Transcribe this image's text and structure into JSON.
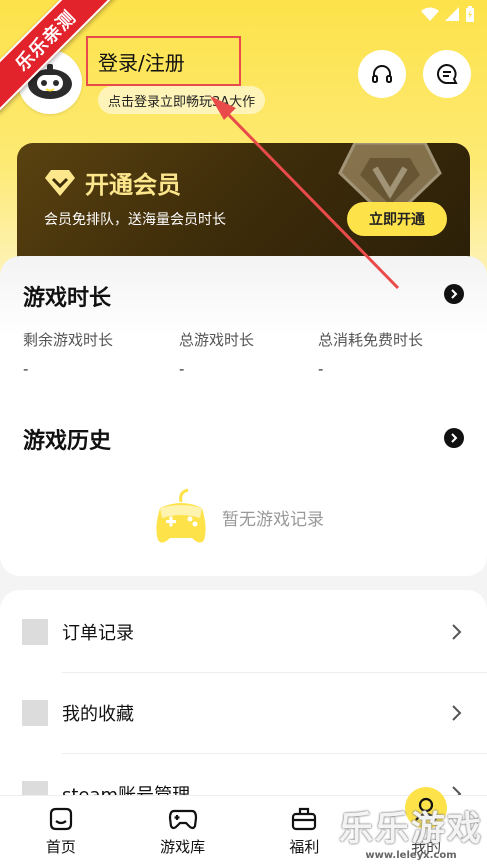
{
  "ribbon": "乐乐亲测",
  "header": {
    "login_label": "登录/注册",
    "login_hint": "点击登录立即畅玩3A大作"
  },
  "vip": {
    "title": "开通会员",
    "subtitle": "会员免排队，送海量会员时长",
    "button": "立即开通"
  },
  "game_time": {
    "title": "游戏时长",
    "stats": [
      {
        "label": "剩余游戏时长",
        "value": "-"
      },
      {
        "label": "总游戏时长",
        "value": "-"
      },
      {
        "label": "总消耗免费时长",
        "value": "-"
      }
    ]
  },
  "history": {
    "title": "游戏历史",
    "empty": "暂无游戏记录"
  },
  "menu": [
    {
      "label": "订单记录"
    },
    {
      "label": "我的收藏"
    },
    {
      "label": "steam账号管理"
    }
  ],
  "nav": [
    {
      "label": "首页",
      "icon": "home-icon"
    },
    {
      "label": "游戏库",
      "icon": "gamepad-icon"
    },
    {
      "label": "福利",
      "icon": "gift-icon"
    },
    {
      "label": "我的",
      "icon": "user-icon"
    }
  ],
  "watermark": {
    "big": "乐乐游戏",
    "small": "www.leleyx.com"
  },
  "colors": {
    "accent": "#fde24a",
    "vip_dark": "#3d2c0a",
    "vip_gold": "#fde78d",
    "annotation_red": "#e94b4b"
  }
}
